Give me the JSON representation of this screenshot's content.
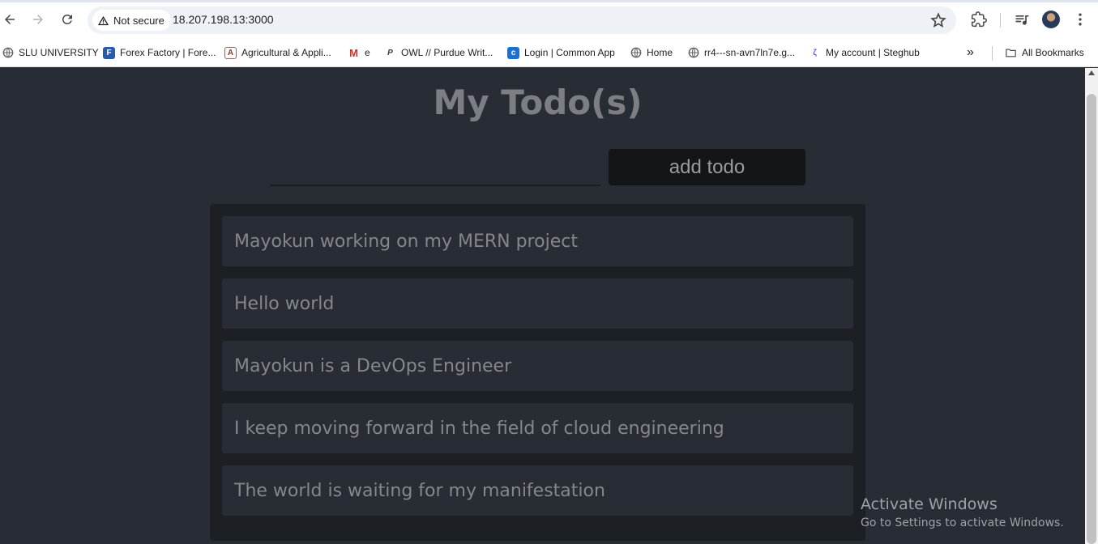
{
  "browser": {
    "security_label": "Not secure",
    "url": "18.207.198.13:3000",
    "bookmarks": [
      {
        "label": "SLU UNIVERSITY",
        "icon": "globe-icon"
      },
      {
        "label": "Forex Factory | Fore...",
        "icon": "forex-factory-icon"
      },
      {
        "label": "Agricultural & Appli...",
        "icon": "agriculture-icon"
      },
      {
        "label": "e",
        "icon": "gmail-icon"
      },
      {
        "label": "OWL // Purdue Writ...",
        "icon": "owl-icon"
      },
      {
        "label": "Login | Common App",
        "icon": "common-app-icon"
      },
      {
        "label": "Home",
        "icon": "globe-icon"
      },
      {
        "label": "rr4---sn-avn7ln7e.g...",
        "icon": "globe-icon"
      },
      {
        "label": "My account | Steghub",
        "icon": "steghub-icon"
      }
    ],
    "all_bookmarks_label": "All Bookmarks"
  },
  "app": {
    "title": "My Todo(s)",
    "input_value": "",
    "add_button_label": "add todo",
    "todos": [
      "Mayokun working on my MERN project",
      "Hello world",
      "Mayokun is a DevOps Engineer",
      "I keep moving forward in the field of cloud engineering",
      "The world is waiting for my manifestation"
    ]
  },
  "watermark": {
    "line1": "Activate Windows",
    "line2": "Go to Settings to activate Windows."
  },
  "colors": {
    "page_background": "#282c34",
    "panel_background": "#1c1f24",
    "button_background": "#141517"
  }
}
